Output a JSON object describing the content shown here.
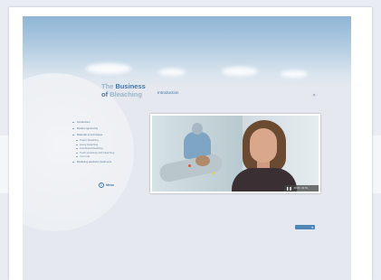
{
  "header": {
    "title_line1_light": "The",
    "title_line1_bold": "Business",
    "title_line2_bold": "of",
    "title_line2_light": "Bleaching",
    "section_title": "Introduction",
    "close_icon": "close-icon"
  },
  "menu": {
    "items": [
      {
        "label": "Introduction",
        "level": 1
      },
      {
        "label": "Market opportunity",
        "level": 1
      },
      {
        "label": "Materials & techniques",
        "level": 1
      },
      {
        "label": "Power bleaching",
        "level": 2
      },
      {
        "label": "Home bleaching",
        "level": 2
      },
      {
        "label": "Combined bleaching",
        "level": 2
      },
      {
        "label": "Tooth sensitivity with bleaching",
        "level": 2
      },
      {
        "label": "Your role",
        "level": 2
      },
      {
        "label": "Marketing aesthetic treatments",
        "level": 1
      }
    ],
    "button_label": "Menu",
    "button_icon": "menu-icon"
  },
  "video": {
    "play_state_icon": "pause-icon",
    "time_display": "00:05 / 00:53"
  },
  "colors": {
    "accent_blue": "#3f77a9",
    "light_title": "#9bb4cc",
    "select_blue": "#4f86ba"
  }
}
